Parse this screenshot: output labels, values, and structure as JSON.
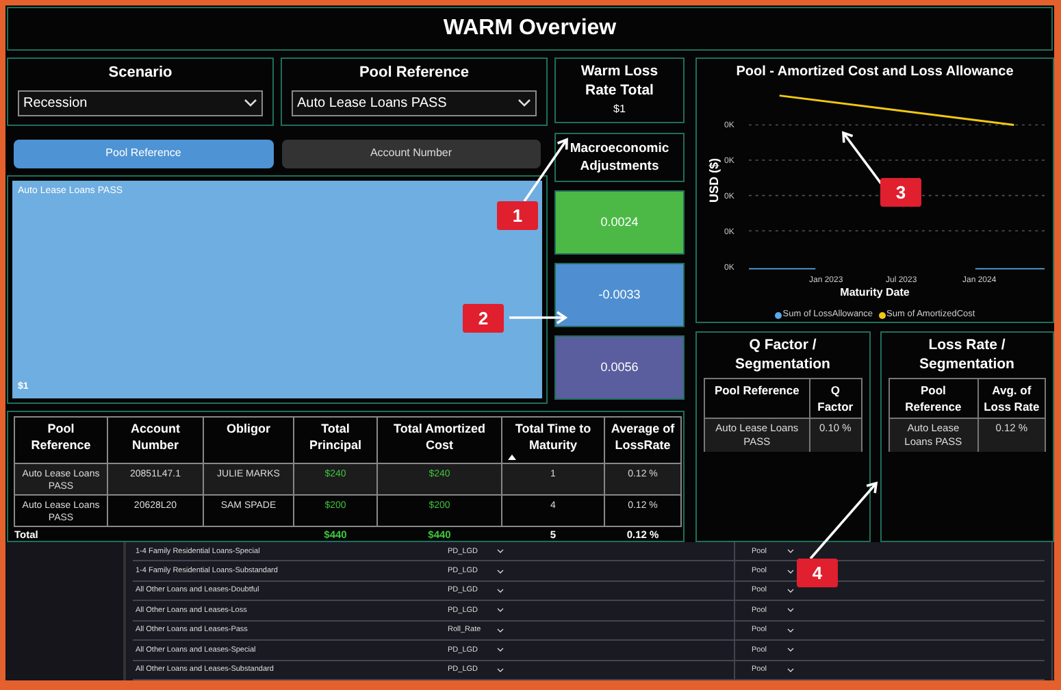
{
  "title": "WARM Overview",
  "filters": [
    {
      "label": "Scenario",
      "value": "Recession"
    },
    {
      "label": "Pool Reference",
      "value": "Auto Lease Loans PASS"
    }
  ],
  "view_tabs": [
    {
      "label": "Pool Reference",
      "selected": true
    },
    {
      "label": "Account Number",
      "selected": false
    }
  ],
  "treemap": {
    "label": "Auto Lease Loans PASS",
    "value": "$1"
  },
  "warm_loss": {
    "title": "Warm Loss Rate Total",
    "value": "$1"
  },
  "macro": {
    "title": "Macroeconomic Adjustments",
    "tiles": [
      {
        "value": "0.0024",
        "color": "#4cb947"
      },
      {
        "value": "-0.0033",
        "color": "#4f8fd1"
      },
      {
        "value": "0.0056",
        "color": "#5a5d9e"
      }
    ]
  },
  "chart": {
    "title": "Pool - Amortized Cost and Loss Allowance",
    "ylabel": "USD ($)",
    "yticks": [
      "0K",
      "0K",
      "0K",
      "0K",
      "0K"
    ],
    "xticks": [
      "Jan 2023",
      "Jul 2023",
      "Jan 2024"
    ],
    "xlabel": "Maturity Date",
    "legend": [
      {
        "name": "Sum of LossAllowance",
        "color": "#5aa8e8"
      },
      {
        "name": "Sum of AmortizedCost",
        "color": "#f2c811"
      }
    ]
  },
  "accounts_table": {
    "columns": [
      {
        "label": "Pool Reference",
        "sorted": false
      },
      {
        "label": "Account Number",
        "sorted": false
      },
      {
        "label": "Obligor",
        "sorted": false
      },
      {
        "label": "Total Principal",
        "sorted": false
      },
      {
        "label": "Total Amortized Cost",
        "sorted": false
      },
      {
        "label": "Total Time to Maturity",
        "sorted": true
      },
      {
        "label": "Average of LossRate",
        "sorted": false
      }
    ],
    "rows": [
      [
        "Auto Lease Loans PASS",
        "20851L47.1",
        "JULIE MARKS",
        "$240",
        "$240",
        "1",
        "0.12 %"
      ],
      [
        "Auto Lease Loans PASS",
        "20628L20",
        "SAM SPADE",
        "$200",
        "$200",
        "4",
        "0.12 %"
      ]
    ],
    "total": {
      "label": "Total",
      "principal": "$440",
      "amortized_cost": "$440",
      "time_to_maturity": "5",
      "loss_rate": "0.12 %"
    }
  },
  "q_factor": {
    "title": "Q Factor / Segmentation",
    "columns": [
      "Pool Reference",
      "Q Factor"
    ],
    "rows": [
      [
        "Auto Lease Loans PASS",
        "0.10 %"
      ]
    ]
  },
  "loss_rate": {
    "title": "Loss Rate / Segmentation",
    "columns": [
      "Pool Reference",
      "Avg. of Loss Rate"
    ],
    "rows": [
      [
        "Auto Lease Loans PASS",
        "0.12 %"
      ]
    ]
  },
  "segmentation_grid": {
    "rows": [
      {
        "name": "1-4 Family Residential Loans-Special",
        "method": "PD_LGD",
        "level": "Pool"
      },
      {
        "name": "1-4 Family Residential Loans-Substandard",
        "method": "PD_LGD",
        "level": "Pool"
      },
      {
        "name": "All Other Loans and Leases-Doubtful",
        "method": "PD_LGD",
        "level": "Pool"
      },
      {
        "name": "All Other Loans and Leases-Loss",
        "method": "PD_LGD",
        "level": "Pool"
      },
      {
        "name": "All Other Loans and Leases-Pass",
        "method": "Roll_Rate",
        "level": "Pool"
      },
      {
        "name": "All Other Loans and Leases-Special",
        "method": "PD_LGD",
        "level": "Pool"
      },
      {
        "name": "All Other Loans and Leases-Substandard",
        "method": "PD_LGD",
        "level": "Pool"
      }
    ]
  },
  "callouts": [
    {
      "label": "1"
    },
    {
      "label": "2"
    },
    {
      "label": "3"
    },
    {
      "label": "4"
    }
  ]
}
